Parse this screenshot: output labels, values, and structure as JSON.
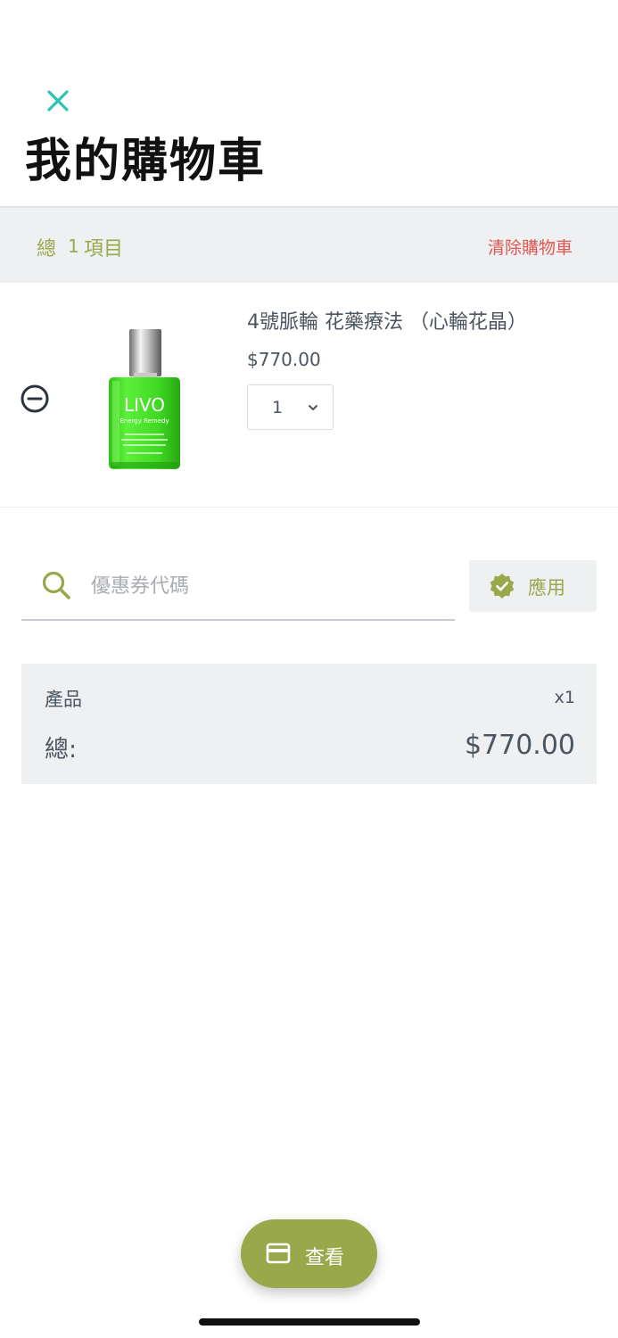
{
  "header": {
    "close_icon": "close-icon",
    "title": "我的購物車"
  },
  "summary_bar": {
    "total_label": "總",
    "item_count": "1",
    "items_label": "項目",
    "clear_label": "清除購物車"
  },
  "cart": {
    "items": [
      {
        "name": "4號脈輪 花藥療法 （心輪花晶）",
        "price": "$770.00",
        "quantity": "1",
        "image_label": "LIVO",
        "image_sublabel": "Energy Remedy"
      }
    ]
  },
  "coupon": {
    "placeholder": "優惠券代碼",
    "value": "",
    "apply_label": "應用"
  },
  "order_summary": {
    "product_label": "產品",
    "product_qty": "x1",
    "total_label": "總:",
    "total_value": "$770.00"
  },
  "checkout": {
    "label": "查看"
  },
  "colors": {
    "accent": "#98a84a",
    "close": "#2bc4b0",
    "danger": "#e0574f",
    "text": "#4a5560",
    "panel": "#eef0f2"
  }
}
